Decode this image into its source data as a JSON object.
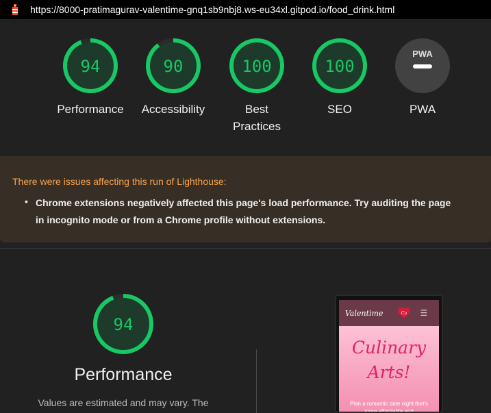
{
  "browser": {
    "url": "https://8000-pratimagurav-valentime-gnq1sb9nbj8.ws-eu34xl.gitpod.io/food_drink.html"
  },
  "scores": [
    {
      "id": "performance",
      "value": 94,
      "label": "Performance"
    },
    {
      "id": "accessibility",
      "value": 90,
      "label": "Accessibility"
    },
    {
      "id": "best-practices",
      "value": 100,
      "label_line1": "Best",
      "label_line2": "Practices"
    },
    {
      "id": "seo",
      "value": 100,
      "label": "SEO"
    },
    {
      "id": "pwa",
      "value": null,
      "badge": "PWA",
      "label": "PWA"
    }
  ],
  "warning": {
    "title": "There were issues affecting this run of Lighthouse:",
    "line1": "Chrome extensions negatively affected this page's load performance. Try auditing the page",
    "line2": "in incognito mode or from a Chrome profile without extensions."
  },
  "performance_section": {
    "score": "94",
    "title": "Performance",
    "subtitle": "Values are estimated and may vary. The"
  },
  "preview": {
    "brand": "Valentime",
    "heart_text": "Cu",
    "hero_line1": "Culinary",
    "hero_line2": "Arts!",
    "hero_text": "Plan a romantic date night that's more affordable and"
  },
  "colors": {
    "pass": "#17c964",
    "pass_bg": "#1e3a2a",
    "warn": "#f7a24a",
    "pwa_bg": "#424242"
  }
}
